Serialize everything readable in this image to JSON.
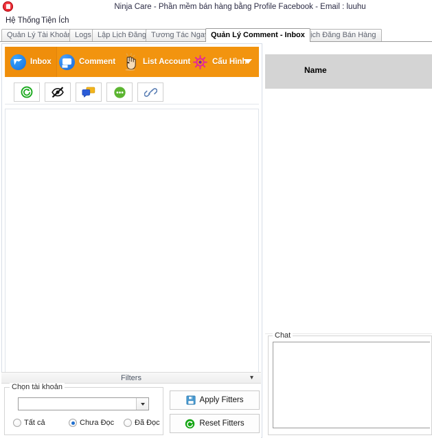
{
  "window": {
    "title": "Ninja Care - Phần mềm bán hàng bằng Profile Facebook - Email : luuhu",
    "app_icon": "ninja-app-icon",
    "accent_orange": "#f2940f",
    "accent_orange_selected": "#ef8e0b",
    "header_gray": "#d4d4d4"
  },
  "menubar": {
    "items": [
      {
        "label": "Hệ Thống"
      },
      {
        "label": "Tiện Ích"
      }
    ]
  },
  "tabs": [
    {
      "label": "Quản Lý Tài Khoản",
      "active": false
    },
    {
      "label": "Logs",
      "active": false
    },
    {
      "label": "Lập Lịch Đăng",
      "active": false
    },
    {
      "label": "Tương Tác Ngay",
      "active": false
    },
    {
      "label": "Quản Lý Comment - Inbox",
      "active": true
    },
    {
      "label": "Lịch Đăng Bán Hàng",
      "active": false
    }
  ],
  "ribbon": {
    "items": [
      {
        "label": "Inbox",
        "icon": "messenger-icon",
        "selected": true
      },
      {
        "label": "Comment",
        "icon": "comment-bubble-icon",
        "selected": false
      },
      {
        "label": "List Account",
        "icon": "hand-click-icon",
        "selected": false
      },
      {
        "label": "Cấu Hình",
        "icon": "gear-icon",
        "selected": false
      }
    ],
    "overflow_icon": "chevron-down-icon"
  },
  "toolbar_buttons": [
    {
      "icon": "refresh-icon",
      "color": "#17a81a"
    },
    {
      "icon": "eye-slash-icon",
      "color": "#1a1a1a"
    },
    {
      "icon": "chat-bubbles-icon",
      "color": "#2a5bd7"
    },
    {
      "icon": "ellipsis-circle-icon",
      "color": "#5cb531"
    },
    {
      "icon": "link-icon",
      "color": "#5b7fb5"
    }
  ],
  "filters": {
    "bar_label": "Filters",
    "collapse_icon": "double-chevron-down-icon",
    "account_group_label": "Chọn tài khoản",
    "account_select_value": "",
    "account_select_placeholder": "",
    "radios": [
      {
        "label": "Tất cả",
        "checked": false
      },
      {
        "label": "Chưa Đọc",
        "checked": true
      },
      {
        "label": "Đã Đọc",
        "checked": false
      }
    ],
    "apply_label": "Apply Fitters",
    "apply_icon": "save-floppy-icon",
    "reset_label": "Reset Fitters",
    "reset_icon": "refresh-icon"
  },
  "right_panel": {
    "name_column_header": "Name",
    "chat_group_label": "Chat",
    "chat_value": ""
  }
}
